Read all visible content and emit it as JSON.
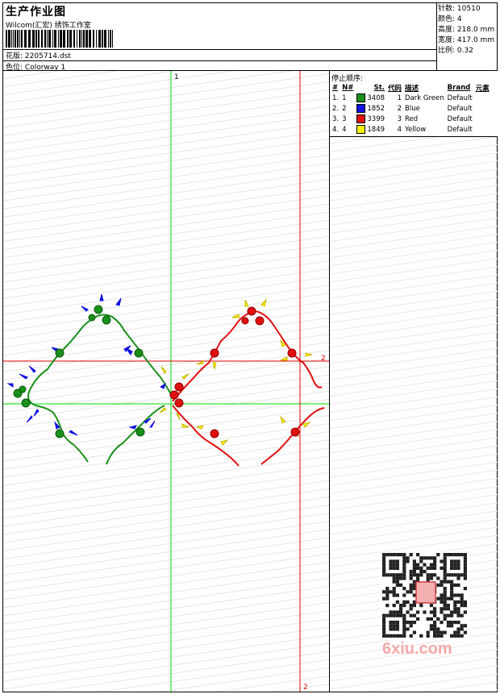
{
  "header": {
    "title": "生产作业图",
    "studio": "Wilcom(汇宏) 绣饰工作室",
    "design_label": "花版:",
    "design_value": "2205714.dst",
    "colorway_label": "色位:",
    "colorway_value": "Colorway 1"
  },
  "stats": {
    "stitches_label": "针数:",
    "stitches": "10510",
    "colors_label": "颜色:",
    "colors": "4",
    "height_label": "高度:",
    "height": "218.0 mm",
    "width_label": "宽度:",
    "width": "417.0 mm",
    "scale_label": "比例:",
    "scale": "0.32"
  },
  "sequence": {
    "title": "停止顺序:",
    "columns": [
      "#",
      "N#",
      "St.",
      "代码",
      "描述",
      "Brand",
      "元素"
    ],
    "rows": [
      {
        "idx": "1.",
        "n": "1",
        "color": "#1a8f1a",
        "st": "3408",
        "code": "1",
        "desc": "Dark Green",
        "brand": "Default"
      },
      {
        "idx": "2.",
        "n": "2",
        "color": "#1010e0",
        "st": "1852",
        "code": "2",
        "desc": "Blue",
        "brand": "Default"
      },
      {
        "idx": "3.",
        "n": "3",
        "color": "#e01010",
        "st": "3399",
        "code": "3",
        "desc": "Red",
        "brand": "Default"
      },
      {
        "idx": "4.",
        "n": "4",
        "color": "#f8f000",
        "st": "1849",
        "code": "4",
        "desc": "Yellow",
        "brand": "Default"
      }
    ]
  },
  "guides": {
    "green_v_label": "1",
    "red_v_label": "2",
    "red_h_label": "2"
  },
  "watermark": "6xiu.com",
  "colors": {
    "dark_green": "#1a8f1a",
    "blue": "#1010e0",
    "red": "#e01010",
    "yellow": "#f8f000",
    "guide_green": "#00dd00",
    "guide_red": "#e00000"
  }
}
